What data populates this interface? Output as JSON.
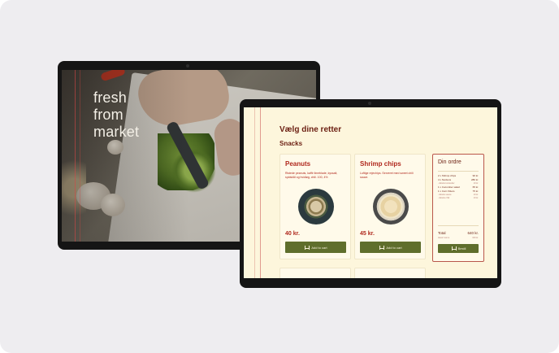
{
  "hero": {
    "headline_line1": "fresh",
    "headline_line2": "from",
    "headline_line3": "market"
  },
  "menu": {
    "page_title": "Vælg dine retter",
    "section_title": "Snacks",
    "cards": [
      {
        "name": "Peanuts",
        "description": "Ristede peanuts, kaffir limeblade, kyssalt, spidskål og hvidløg, chili. 100, 4%",
        "price": "40 kr.",
        "button_label": "Add to cart"
      },
      {
        "name": "Shrimp chips",
        "description": "Luftige rejechips. Serveret med sweet chili sauce.",
        "price": "45 kr.",
        "button_label": "Add to cart"
      }
    ]
  },
  "order": {
    "title": "Din ordre",
    "items": [
      {
        "label": "2 x Shrimp chips",
        "amount": "90 kr.",
        "sub": false
      },
      {
        "label": "4 x Nordens",
        "amount": "280 kr.",
        "sub": false
      },
      {
        "label": "- Ekstra koriander",
        "amount": "10 kr.",
        "sub": true
      },
      {
        "label": "1 x Cucumber salad",
        "amount": "65 kr.",
        "sub": false
      },
      {
        "label": "1 x Corn fritters",
        "amount": "75 kr.",
        "sub": false
      },
      {
        "label": "- Ekstra sauce",
        "amount": "10 kr.",
        "sub": true
      },
      {
        "label": "- Ekstra chili",
        "amount": "10 kr.",
        "sub": true
      }
    ],
    "total_label": "Total",
    "total_value": "640 kr.",
    "moms_label": "Heraf moms",
    "moms_value": "160 kr.",
    "order_button_label": "Bestil"
  },
  "colors": {
    "accent_red": "#b0281d",
    "button_green": "#5f6e2c",
    "screen_cream": "#fdf6dc"
  },
  "icons": {
    "add_to_cart": "cart-icon",
    "order": "cart-icon"
  }
}
